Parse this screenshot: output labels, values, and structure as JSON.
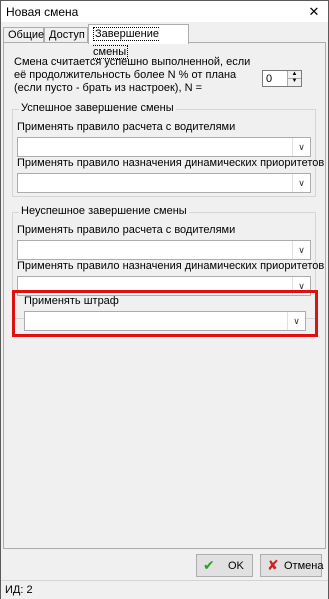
{
  "window": {
    "title": "Новая смена",
    "close_glyph": "✕"
  },
  "tabs": [
    {
      "label": "Общие",
      "active": false
    },
    {
      "label": "Доступ",
      "active": false
    },
    {
      "label": "Завершение смены",
      "active": true
    }
  ],
  "completion": {
    "description": "Смена считается успешно выполненной, если её продолжительность более N % от плана (если пусто - брать из настроек), N =",
    "n_value": "0"
  },
  "success_group": {
    "title": "Успешное завершение смены",
    "driver_rule_label": "Применять правило расчета с водителями",
    "driver_rule_value": "",
    "priority_rule_label": "Применять правило назначения динамических приоритетов",
    "priority_rule_value": ""
  },
  "fail_group": {
    "title": "Неуспешное завершение смены",
    "driver_rule_label": "Применять правило расчета с водителями",
    "driver_rule_value": "",
    "priority_rule_label": "Применять правило назначения динамических приоритетов",
    "priority_rule_value": ""
  },
  "penalty": {
    "label": "Применять штраф",
    "value": ""
  },
  "buttons": {
    "ok_label": "OK",
    "cancel_label": "Отмена"
  },
  "status": {
    "id_text": "ИД: 2"
  },
  "colors": {
    "highlight": "#e01010",
    "ok_check": "#2e9e2e",
    "cancel_x": "#d42020"
  },
  "icons": {
    "combo_arrow": "chevron-down-icon",
    "ok": "check-icon",
    "cancel": "x-icon"
  }
}
